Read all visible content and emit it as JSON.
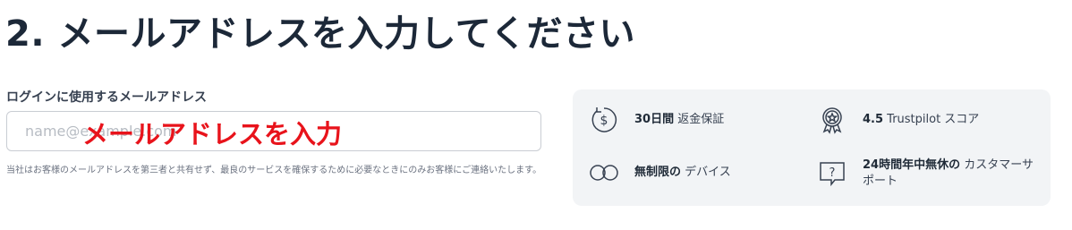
{
  "heading": "2. メールアドレスを入力してください",
  "email_field": {
    "label": "ログインに使用するメールアドレス",
    "placeholder": "name@example.com",
    "value": ""
  },
  "annotation": "メールアドレスを入力",
  "privacy_note": "当社はお客様のメールアドレスを第三者と共有せず、最良のサービスを確保するために必要なときにのみお客様にご連絡いたします。",
  "benefits": [
    {
      "icon": "money-back-icon",
      "strong": "30日間",
      "text": " 返金保証"
    },
    {
      "icon": "award-icon",
      "strong": "4.5",
      "text": " Trustpilot スコア"
    },
    {
      "icon": "infinity-icon",
      "strong": "無制限の",
      "text": " デバイス"
    },
    {
      "icon": "support-chat-icon",
      "strong": "24時間年中無休の",
      "text": " カスタマーサポート"
    }
  ],
  "colors": {
    "heading": "#1c2838",
    "annotation": "#e8131b",
    "panel_background": "#f2f4f6",
    "input_border": "#c9cdd3"
  }
}
